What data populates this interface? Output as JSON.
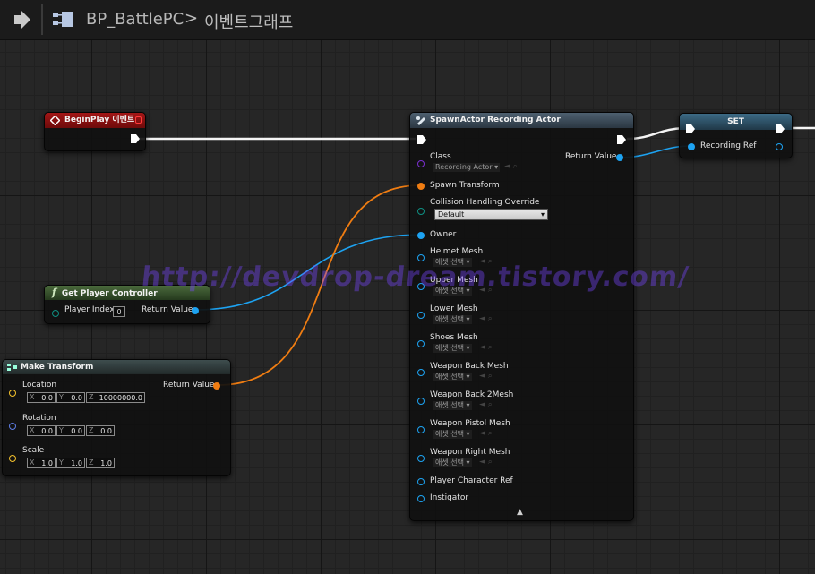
{
  "header": {
    "blueprint_name": "BP_BattlePC",
    "chevron": ">",
    "graph_name": "이벤트그래프"
  },
  "nodes": {
    "begin_play": {
      "title": "BeginPlay 이벤트"
    },
    "spawn_actor": {
      "title": "SpawnActor Recording Actor",
      "class_label": "Class",
      "class_value": "Recording Actor ▾",
      "return_label": "Return Value",
      "spawn_transform": "Spawn Transform",
      "collision_label": "Collision Handling Override",
      "collision_value": "Default",
      "owner": "Owner",
      "mesh_pins": [
        {
          "label": "Helmet Mesh",
          "value": "애셋 선택 ▾"
        },
        {
          "label": "Upper Mesh",
          "value": "애셋 선택 ▾"
        },
        {
          "label": "Lower Mesh",
          "value": "애셋 선택 ▾"
        },
        {
          "label": "Shoes Mesh",
          "value": "애셋 선택 ▾"
        },
        {
          "label": "Weapon Back Mesh",
          "value": "애셋 선택 ▾"
        },
        {
          "label": "Weapon Back 2Mesh",
          "value": "애셋 선택 ▾"
        },
        {
          "label": "Weapon Pistol Mesh",
          "value": "애셋 선택 ▾"
        },
        {
          "label": "Weapon Right Mesh",
          "value": "애셋 선택 ▾"
        }
      ],
      "player_character_ref": "Player Character Ref",
      "instigator": "Instigator",
      "collapse_arrow": "▲"
    },
    "set": {
      "title": "SET",
      "recording_ref": "Recording Ref"
    },
    "get_player_controller": {
      "title": "Get Player Controller",
      "func_icon": "f",
      "player_index_label": "Player Index",
      "player_index_value": "0",
      "return_label": "Return Value"
    },
    "make_transform": {
      "title": "Make Transform",
      "return_label": "Return Value",
      "location_label": "Location",
      "location": {
        "x": "0.0",
        "y": "0.0",
        "z": "10000000.0"
      },
      "rotation_label": "Rotation",
      "rotation": {
        "x": "0.0",
        "y": "0.0",
        "z": "0.0"
      },
      "scale_label": "Scale",
      "scale": {
        "x": "1.0",
        "y": "1.0",
        "z": "1.0"
      }
    }
  },
  "axes": {
    "x": "X",
    "y": "Y",
    "z": "Z"
  },
  "watermark": "http://devdrop-dream.tistory.com/",
  "colors": {
    "exec": "#ffffff",
    "object_pin": "#1da3f2",
    "struct_pin": "#f07d12",
    "begin_play_header": "#8b1010",
    "spawn_header": "#3b4a58",
    "set_header": "#2a4a5e",
    "function_header": "#35512c"
  },
  "icons": {
    "back": "arrow-right-icon",
    "blueprint": "blueprint-graph-icon",
    "event": "event-diamond-icon",
    "function": "function-icon",
    "spawn": "spawn-actor-icon",
    "make_transform": "struct-make-icon"
  }
}
